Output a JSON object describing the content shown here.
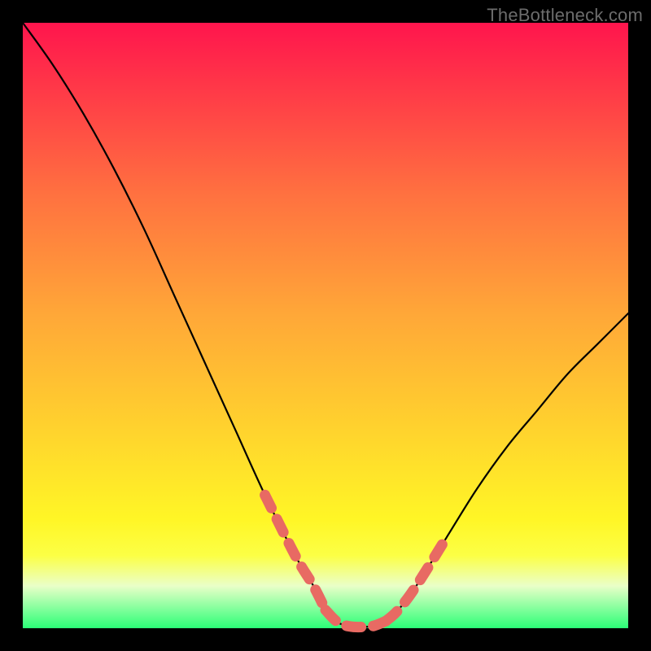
{
  "watermark": "TheBottleneck.com",
  "colors": {
    "overlay_stroke": "#e86a63",
    "curve_stroke": "#000000"
  },
  "chart_data": {
    "type": "line",
    "title": "",
    "xlabel": "",
    "ylabel": "",
    "xlim": [
      0,
      100
    ],
    "ylim": [
      0,
      100
    ],
    "grid": false,
    "series": [
      {
        "name": "curve",
        "x": [
          0,
          5,
          10,
          15,
          20,
          25,
          30,
          35,
          40,
          45,
          48,
          50,
          52,
          54,
          56,
          58,
          60,
          62,
          65,
          70,
          75,
          80,
          85,
          90,
          95,
          100
        ],
        "y": [
          100,
          93,
          85,
          76,
          66,
          55,
          44,
          33,
          22,
          12,
          7,
          3,
          1,
          0.3,
          0.2,
          0.4,
          1.2,
          3,
          7,
          15,
          23,
          30,
          36,
          42,
          47,
          52
        ]
      }
    ],
    "overlay_segments": [
      {
        "side": "left",
        "x_range": [
          38,
          50
        ],
        "note": "dashed coral segment on descending limb"
      },
      {
        "side": "floor",
        "x_range": [
          50,
          60
        ],
        "note": "dashed coral segment along minimum"
      },
      {
        "side": "right",
        "x_range": [
          60,
          70
        ],
        "note": "dashed coral segment on ascending limb"
      }
    ]
  }
}
